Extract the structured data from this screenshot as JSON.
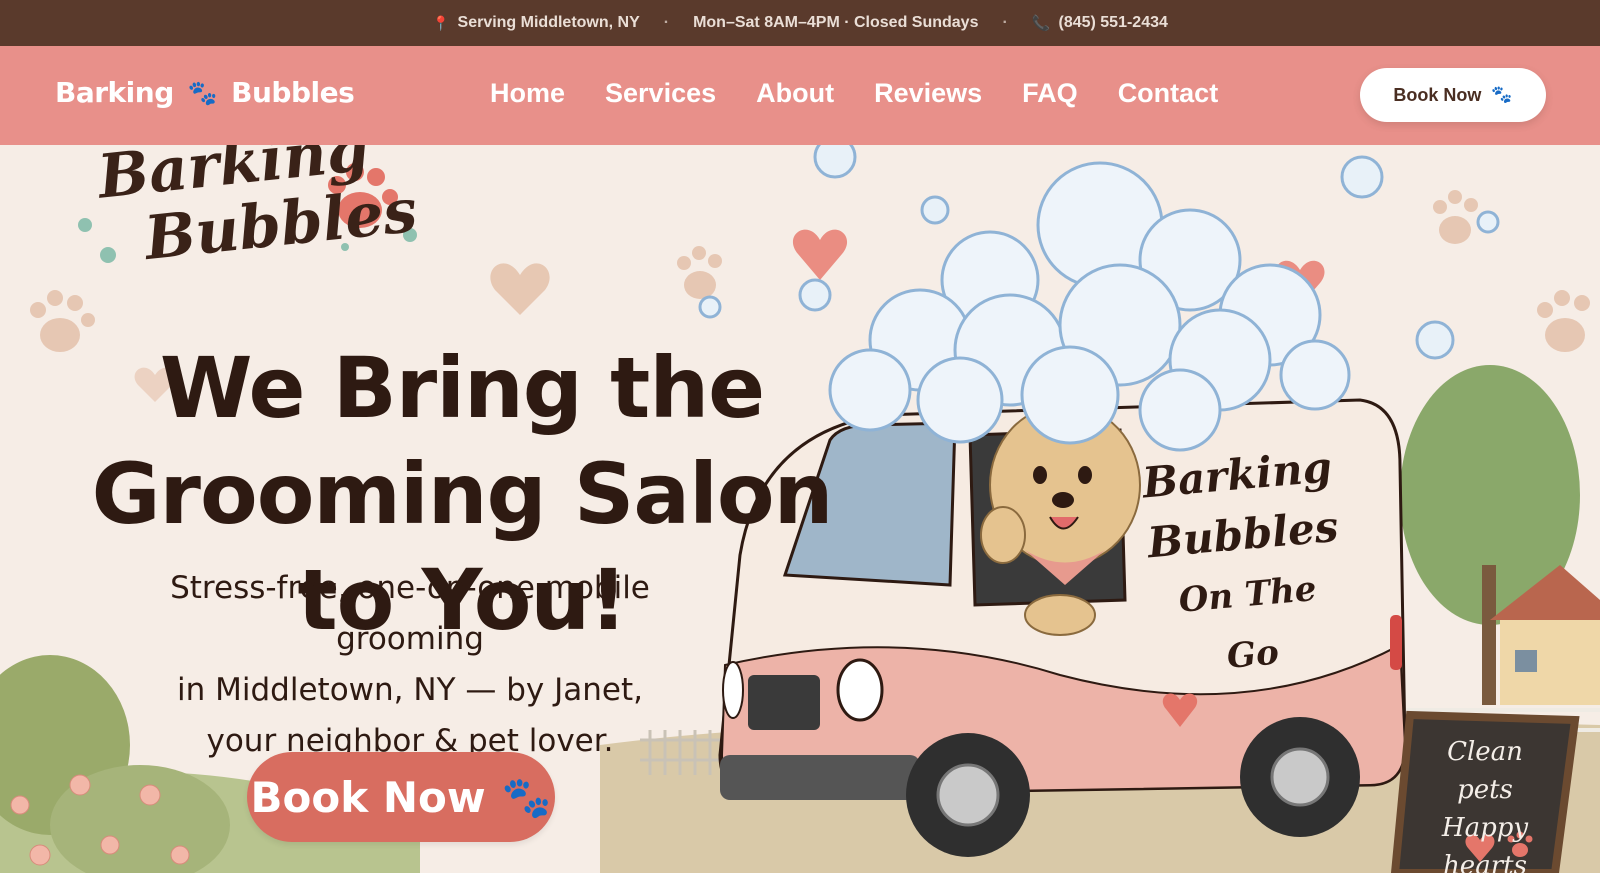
{
  "topbar": {
    "location": "Serving Middletown, NY",
    "hours": "Mon–Sat 8AM–4PM · Closed Sundays",
    "phone": "(845) 551-2434",
    "separator": "·"
  },
  "nav": {
    "brand_left": "Barking",
    "brand_right": "Bubbles",
    "links": [
      "Home",
      "Services",
      "About",
      "Reviews",
      "FAQ",
      "Contact"
    ],
    "cta": "Book Now"
  },
  "hero": {
    "logo_line1": "Barking",
    "logo_line2": "Bubbles",
    "headline_line1": "We Bring the",
    "headline_line2": "Grooming Salon to You!",
    "sub_line1": "Stress-free, one-on-one mobile grooming",
    "sub_line2": "in Middletown, NY — by Janet,",
    "sub_line3": "your neighbor & pet lover.",
    "cta": "Book Now",
    "van_line1": "Barking",
    "van_line2": "Bubbles",
    "van_line3": "On The Go",
    "sign_line1": "Clean pets",
    "sign_line2": "Happy hearts"
  },
  "icons": {
    "location": "map-pin-icon",
    "phone": "phone-icon",
    "paw": "paw-icon"
  },
  "colors": {
    "topbar": "#5a3a2c",
    "nav": "#e8908a",
    "hero_bg": "#f6ede6",
    "cta": "#d86d60",
    "text_dark": "#2e1a12"
  }
}
